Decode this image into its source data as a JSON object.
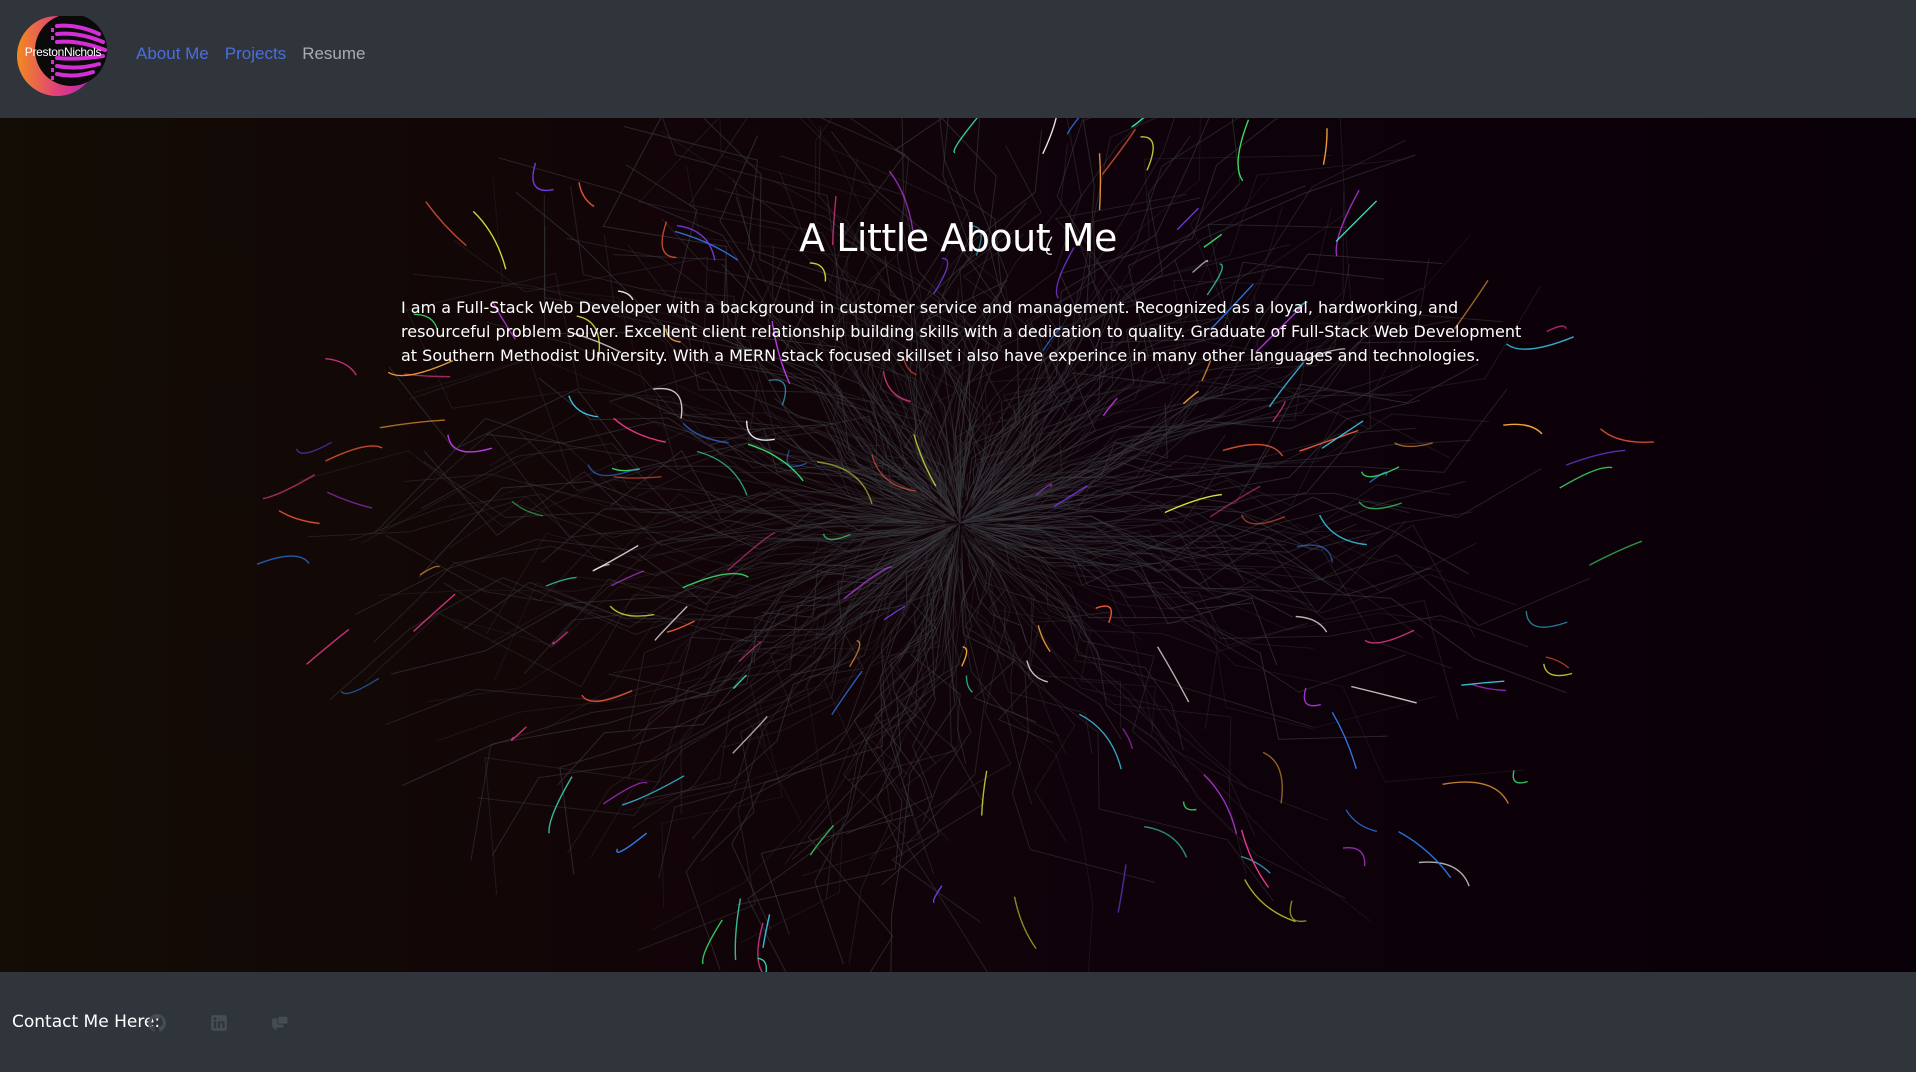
{
  "nav": {
    "logo_text": "PrestonNichols",
    "links": [
      {
        "label": "About Me"
      },
      {
        "label": "Projects"
      },
      {
        "label": "Resume"
      }
    ]
  },
  "hero": {
    "title": "A Little About Me",
    "body": "I am a Full-Stack Web Developer with a background in customer service and management. Recognized as a loyal, hardworking, and resourceful problem solver. Excellent client relationship building skills with a dedication to quality. Graduate of Full-Stack Web Development at Southern Methodist University. With a MERN stack focused skillset i also have experince in many other languages and technologies."
  },
  "footer": {
    "contact_label": "Contact Me Here:",
    "icons": [
      "github-icon",
      "linkedin-icon",
      "email-icon"
    ]
  },
  "colors": {
    "nav_bg": "#2f353a",
    "link_active": "#4a6fdc",
    "link_muted": "#a7adb3"
  }
}
